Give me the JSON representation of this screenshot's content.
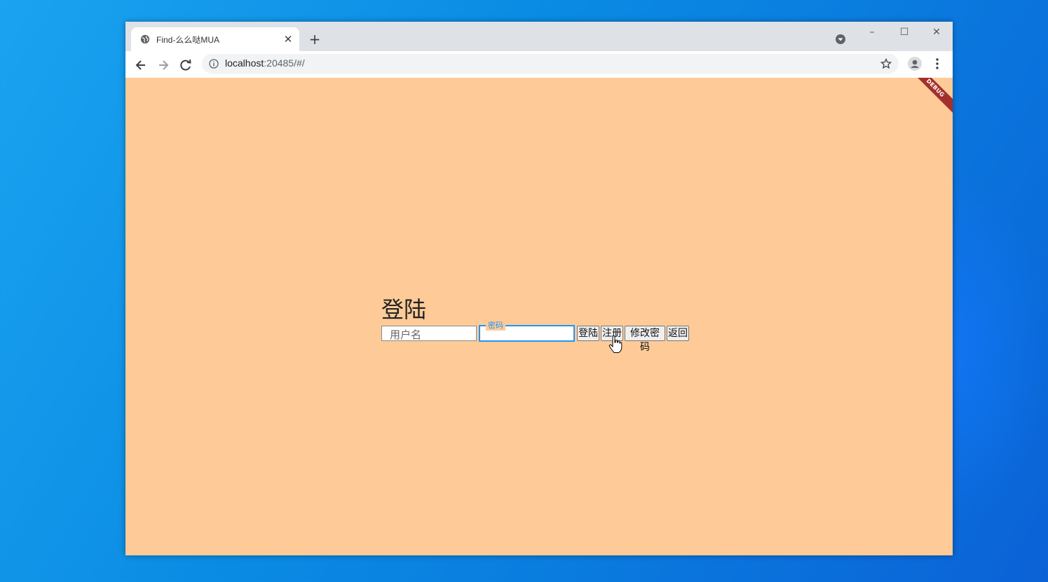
{
  "browser": {
    "tab_title": "Find-么么哒MUA",
    "url_host": "localhost",
    "url_rest": ":20485/#/",
    "new_tab_symbol": "+",
    "close_tab_symbol": "✕"
  },
  "window_controls": {
    "minimize": "–",
    "maximize": "☐",
    "close": "✕"
  },
  "page": {
    "debug_banner": "DEBUG",
    "heading": "登陆",
    "username_placeholder": "用户名",
    "password_label": "密码",
    "buttons": {
      "login": "登陆",
      "register": "注册",
      "change_password": "修改密码",
      "back": "返回"
    }
  },
  "colors": {
    "page_background": "#fecb98",
    "focus_accent": "#2196f3",
    "debug_banner": "#a3302b"
  },
  "icons": [
    "globe-icon",
    "close-icon",
    "plus-icon",
    "tab-search-icon",
    "back-arrow-icon",
    "forward-arrow-icon",
    "reload-icon",
    "info-icon",
    "star-icon",
    "profile-icon",
    "menu-icon",
    "hand-cursor-icon"
  ]
}
